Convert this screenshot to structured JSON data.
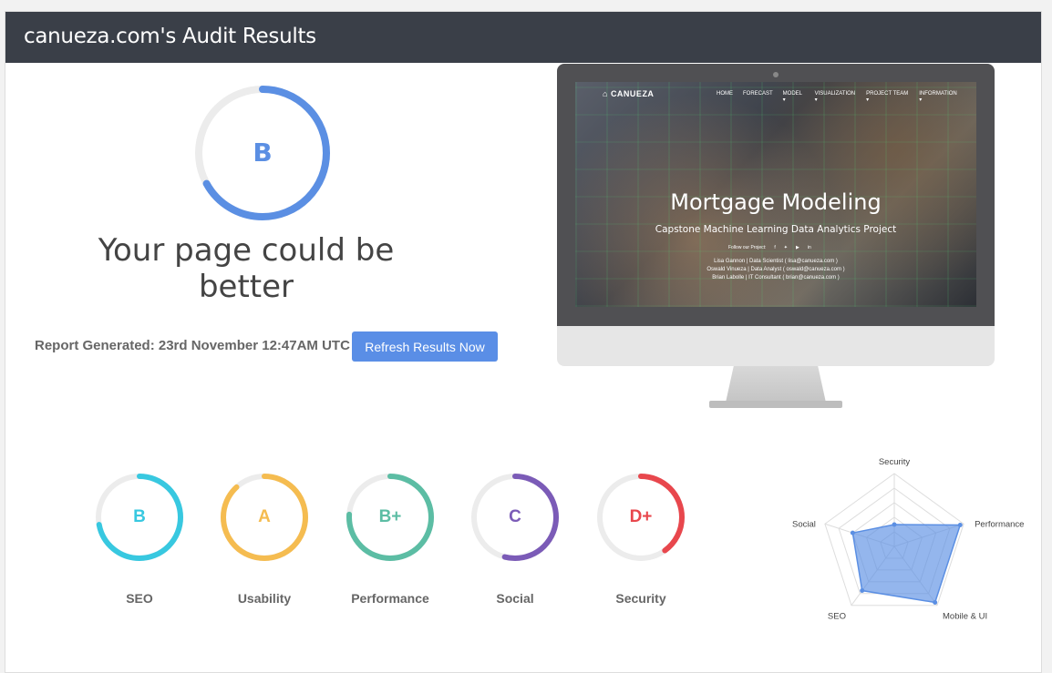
{
  "header": {
    "title": "canueza.com's Audit Results"
  },
  "overall": {
    "grade": "B",
    "score": 0.67,
    "color": "#5b8fe3",
    "headline": "Your page could be better"
  },
  "report": {
    "label": "Report Generated: 23rd November 12:47AM UTC",
    "refresh_label": "Refresh Results Now"
  },
  "preview": {
    "brand": "CANUEZA",
    "nav": [
      "HOME",
      "FORECAST",
      "MODEL ▾",
      "VISUALIZATION ▾",
      "PROJECT TEAM ▾",
      "INFORMATION ▾"
    ],
    "title": "Mortgage Modeling",
    "subtitle": "Capstone Machine Learning Data Analytics Project",
    "follow": "Follow our Project:",
    "social_icons": [
      "facebook-icon",
      "twitter-icon",
      "youtube-icon",
      "linkedin-icon"
    ],
    "credits": [
      "Lisa Gannon | Data Scientist ( lisa@canueza.com )",
      "Oswald Vinueza | Data Analyst ( oswald@canueza.com )",
      "Brian Labolle | IT Consultant ( brian@canueza.com )"
    ]
  },
  "categories": [
    {
      "name": "SEO",
      "grade": "B",
      "score": 0.72,
      "color": "#38c8e0"
    },
    {
      "name": "Usability",
      "grade": "A",
      "score": 0.88,
      "color": "#f5bc50"
    },
    {
      "name": "Performance",
      "grade": "B+",
      "score": 0.76,
      "color": "#5cbda4"
    },
    {
      "name": "Social",
      "grade": "C",
      "score": 0.54,
      "color": "#7b5bb7"
    },
    {
      "name": "Security",
      "grade": "D+",
      "score": 0.4,
      "color": "#e8474d"
    }
  ],
  "radar": {
    "axes": [
      "Security",
      "Performance",
      "Mobile & UI",
      "SEO",
      "Social"
    ],
    "values": [
      0.3,
      0.95,
      0.95,
      0.75,
      0.6
    ],
    "fill": "#5b8fe3"
  }
}
